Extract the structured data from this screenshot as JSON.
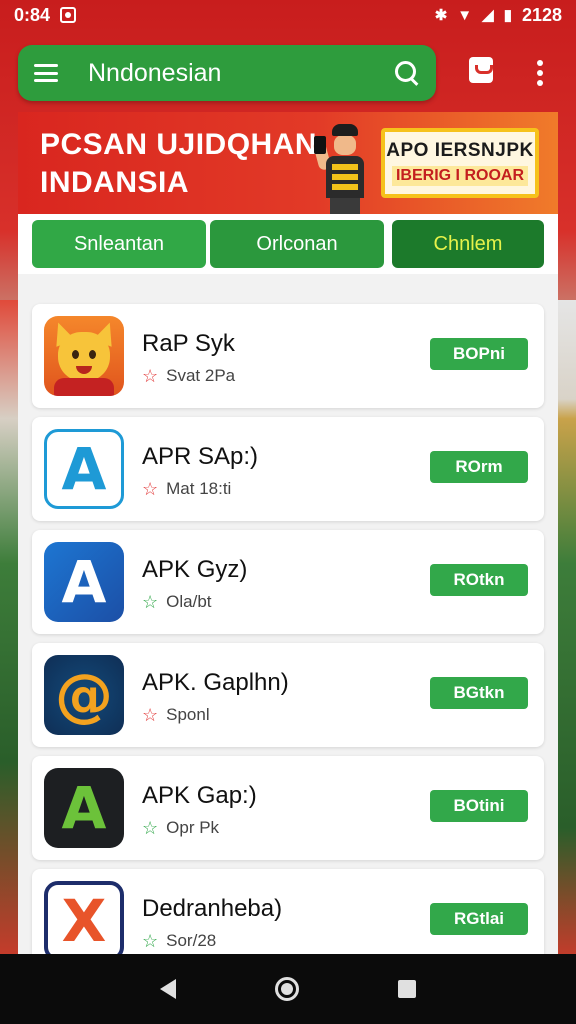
{
  "status_bar": {
    "time": "0:84",
    "battery_text": "2128"
  },
  "app_bar": {
    "title": "Nndonesian"
  },
  "banner": {
    "title": "PCSAN UJIDQHAN INDANSIA",
    "promo_line1": "APO IERSNJPK",
    "promo_line2": "IBERIG I ROOAR"
  },
  "tabs": [
    {
      "label": "Snleantan"
    },
    {
      "label": "Orlconan"
    },
    {
      "label": "Chnlem"
    }
  ],
  "apps": [
    {
      "name": "RaP Syk",
      "meta": "Svat 2Pa",
      "button": "BOPni",
      "star_color": "red",
      "icon": "fox-mascot-icon"
    },
    {
      "name": "APR SAp:)",
      "meta": "Mat 18:ti",
      "button": "ROrm",
      "star_color": "red",
      "icon": "apk-a-icon"
    },
    {
      "name": "APK Gyz)",
      "meta": "Ola/bt",
      "button": "ROtkn",
      "star_color": "green",
      "icon": "apk-a-blue-icon"
    },
    {
      "name": "APK. Gaplhn)",
      "meta": "Sponl",
      "button": "BGtkn",
      "star_color": "red",
      "icon": "apk-swirl-icon"
    },
    {
      "name": "APK Gap:)",
      "meta": "Opr Pk",
      "button": "BOtini",
      "star_color": "green",
      "icon": "apk-a-dark-icon"
    },
    {
      "name": "Dedranheba)",
      "meta": "Sor/28",
      "button": "RGtlai",
      "star_color": "green",
      "icon": "apk-x-icon"
    }
  ],
  "colors": {
    "primary_green": "#2e9c3d",
    "banner_red": "#d9261f",
    "accent_yellow": "#e6f24a"
  }
}
